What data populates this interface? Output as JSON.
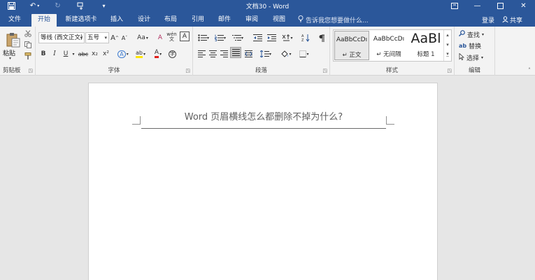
{
  "window": {
    "title": "文档30 - Word",
    "qat_icons": [
      "save-icon",
      "undo-icon",
      "redo-icon",
      "touch-mode-icon",
      "customize-qat-icon"
    ]
  },
  "tabs": [
    {
      "label": "文件",
      "active": false
    },
    {
      "label": "开始",
      "active": true
    },
    {
      "label": "新建选项卡",
      "active": false
    },
    {
      "label": "插入",
      "active": false
    },
    {
      "label": "设计",
      "active": false
    },
    {
      "label": "布局",
      "active": false
    },
    {
      "label": "引用",
      "active": false
    },
    {
      "label": "邮件",
      "active": false
    },
    {
      "label": "审阅",
      "active": false
    },
    {
      "label": "视图",
      "active": false
    }
  ],
  "tell_me": "告诉我您想要做什么...",
  "login": "登录",
  "share": "共享",
  "clipboard": {
    "paste": "粘贴",
    "label": "剪贴板"
  },
  "font": {
    "family": "等线 (西文正文)",
    "size": "五号",
    "bold": "B",
    "italic": "I",
    "underline": "U",
    "strike": "abc",
    "subscript": "x₂",
    "superscript": "x²",
    "grow": "A",
    "shrink": "A",
    "case": "Aa",
    "clear": "A",
    "phonetic": "wén",
    "border": "A",
    "effects": "A",
    "highlight": "ab",
    "color": "A",
    "circle": "字",
    "label": "字体"
  },
  "paragraph": {
    "label": "段落"
  },
  "styles": {
    "items": [
      {
        "sample": "AaBbCcDı",
        "name": "正文",
        "selected": true
      },
      {
        "sample": "AaBbCcDı",
        "name": "无间隔",
        "selected": false
      },
      {
        "sample": "AaBl",
        "name": "标题 1",
        "selected": false
      }
    ],
    "label": "样式"
  },
  "editing": {
    "find": "查找",
    "replace": "替换",
    "select": "选择",
    "label": "编辑"
  },
  "document": {
    "header_text": "Word 页眉横线怎么都删除不掉为什么?"
  },
  "colors": {
    "accent": "#2b579a",
    "highlight": "#ffe600",
    "font_color": "#e0201b"
  }
}
